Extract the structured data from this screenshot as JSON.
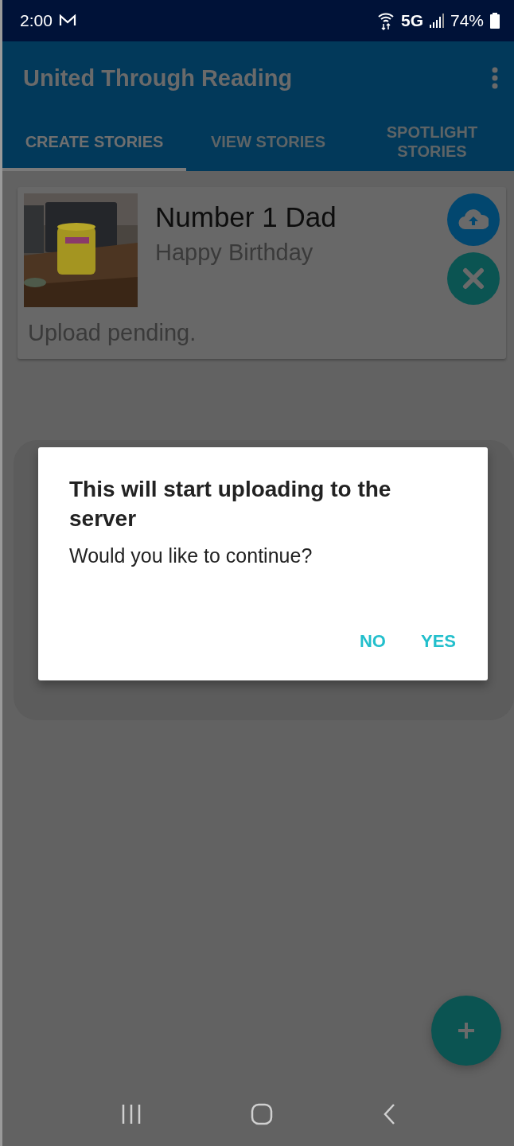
{
  "status_bar": {
    "time": "2:00",
    "network": "5G",
    "battery": "74%"
  },
  "app_bar": {
    "title": "United Through Reading"
  },
  "tabs": [
    {
      "label": "CREATE STORIES",
      "selected": true
    },
    {
      "label": "VIEW STORIES",
      "selected": false
    },
    {
      "label": "SPOTLIGHT STORIES",
      "selected": false
    }
  ],
  "stories": [
    {
      "title": "Number 1 Dad",
      "subtitle": "Happy Birthday",
      "status": "Upload pending."
    }
  ],
  "dialog": {
    "title": "This will start uploading to the server",
    "message": "Would you like to continue?",
    "buttons": [
      "NO",
      "YES"
    ]
  }
}
